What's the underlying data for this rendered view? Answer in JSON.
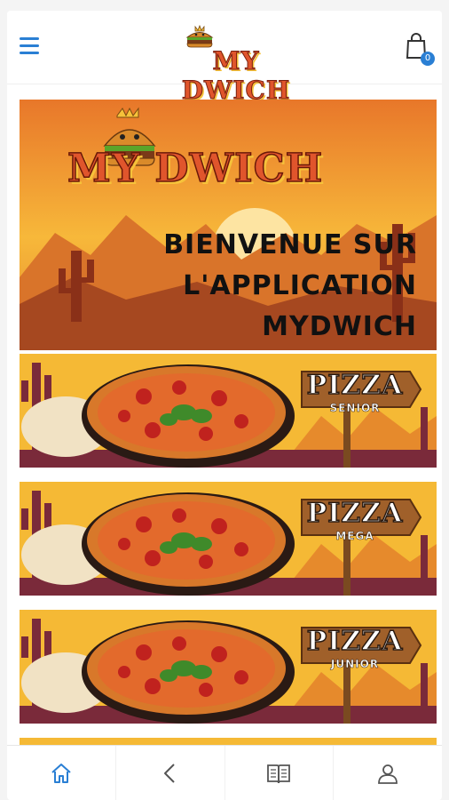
{
  "header": {
    "logo_text": "MY DWICH",
    "cart_count": "0",
    "icons": [
      "menu-icon",
      "shopping-bag-icon"
    ]
  },
  "hero": {
    "logo_text": "MY DWICH",
    "line1": "BIENVENUE SUR",
    "line2": "L'APPLICATION",
    "line3": "MYDWICH"
  },
  "promos": [
    {
      "title": "PIZZA",
      "subtitle": "SENIOR"
    },
    {
      "title": "PIZZA",
      "subtitle": "MEGA"
    },
    {
      "title": "PIZZA",
      "subtitle": "JUNIOR"
    }
  ],
  "bottom_nav": {
    "items": [
      "home-icon",
      "back-icon",
      "menu-book-icon",
      "user-icon"
    ],
    "active": "home-icon"
  },
  "colors": {
    "accent": "#2a7fd4",
    "brand_orange": "#e0552c",
    "brand_yellow": "#f6c23a"
  }
}
